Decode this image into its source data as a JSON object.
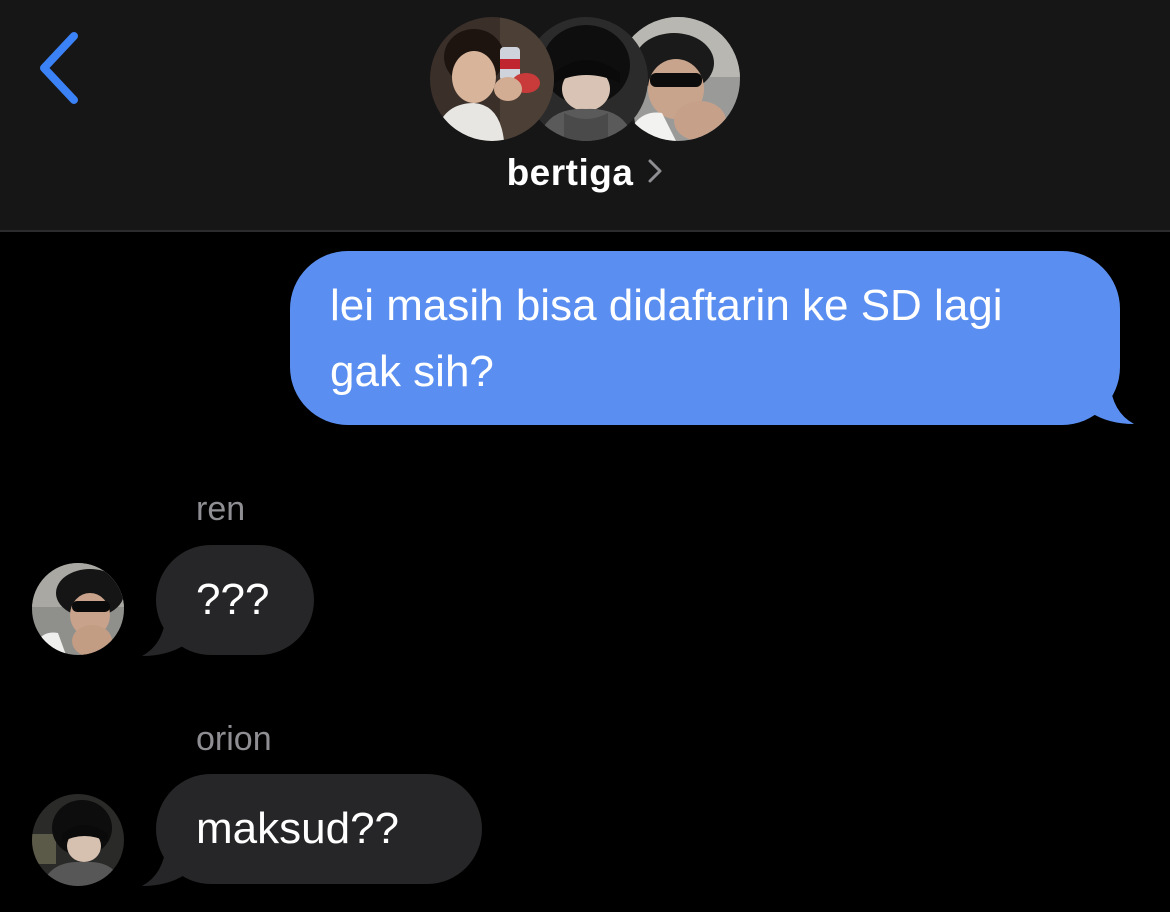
{
  "header": {
    "back_icon": "chevron-left-icon",
    "group_name": "bertiga",
    "chevron_icon": "chevron-right-icon",
    "accent_color": "#3a82f6"
  },
  "messages": [
    {
      "direction": "outgoing",
      "text": "lei masih bisa didaftarin ke SD lagi gak sih?",
      "bubble_color": "#5a8ff1"
    },
    {
      "direction": "incoming",
      "sender": "ren",
      "text": "???",
      "bubble_color": "#262628"
    },
    {
      "direction": "incoming",
      "sender": "orion",
      "text": "maksud??",
      "bubble_color": "#262628"
    }
  ]
}
